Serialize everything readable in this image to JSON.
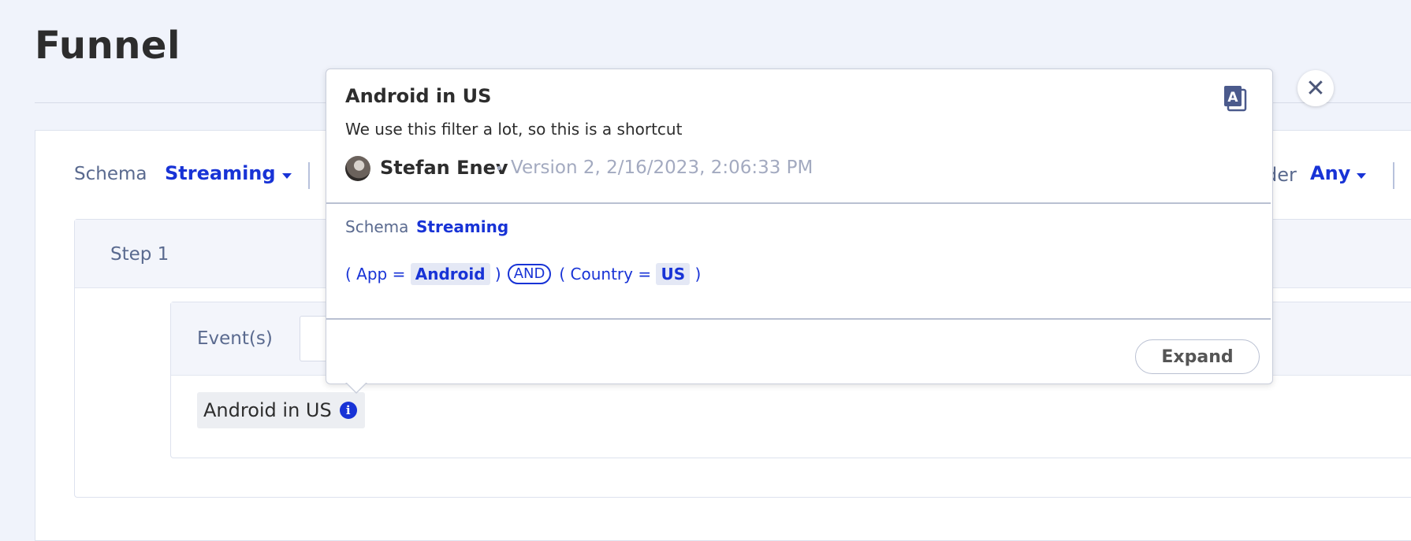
{
  "page": {
    "title": "Funnel"
  },
  "toolbar": {
    "schema_label": "Schema",
    "schema_value": "Streaming",
    "order_label_partial": "der",
    "order_value": "Any"
  },
  "step": {
    "label": "Step 1",
    "events_label": "Event(s)",
    "chip_label": "Android in US"
  },
  "popover": {
    "title": "Android in US",
    "description": "We use this filter a lot, so this is a shortcut",
    "author": "Stefan Enev",
    "separator": "•",
    "version": "Version 2, 2/16/2023, 2:06:33 PM",
    "schema_label": "Schema",
    "schema_value": "Streaming",
    "filter": {
      "open1": "( ",
      "field1": "App",
      "op1": " = ",
      "value1": "Android",
      "close1": " )",
      "conj": "AND",
      "open2": "( ",
      "field2": "Country",
      "op2": " = ",
      "value2": "US",
      "close2": " )"
    },
    "expand_label": "Expand"
  },
  "icons": {
    "close": "close-icon",
    "copy": "copy-icon",
    "info": "info-icon",
    "avatar": "avatar"
  },
  "colors": {
    "accent": "#1833d6",
    "background": "#f0f3fb",
    "muted": "#5a6a8f"
  }
}
